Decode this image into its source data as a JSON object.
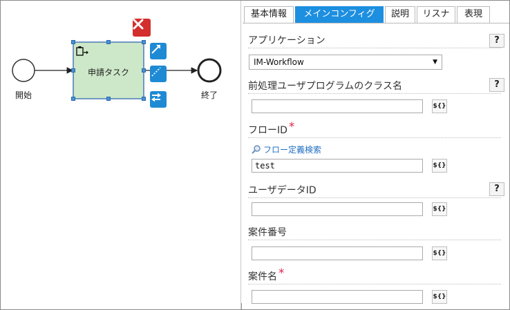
{
  "canvas": {
    "start_label": "開始",
    "task_label": "申請タスク",
    "end_label": "終了"
  },
  "tabs": [
    {
      "label": "基本情報",
      "active": false
    },
    {
      "label": "メインコンフィグ",
      "active": true
    },
    {
      "label": "説明",
      "active": false
    },
    {
      "label": "リスナ",
      "active": false
    },
    {
      "label": "表現",
      "active": false
    }
  ],
  "form": {
    "application": {
      "label": "アプリケーション",
      "help": "?",
      "selected": "IM-Workflow"
    },
    "preprocess": {
      "label": "前処理ユーザプログラムのクラス名",
      "help": "?",
      "value": "",
      "var_button": "${}"
    },
    "flow_id": {
      "label": "フローID",
      "required_mark": "*",
      "search_link": "フロー定義検索",
      "value": "test",
      "var_button": "${}"
    },
    "user_data_id": {
      "label": "ユーザデータID",
      "help": "?",
      "value": "",
      "var_button": "${}"
    },
    "matter_number": {
      "label": "案件番号",
      "value": "",
      "var_button": "${}"
    },
    "matter_name": {
      "label": "案件名",
      "required_mark": "*",
      "value": "",
      "var_button": "${}"
    }
  },
  "colors": {
    "accent": "#1d8fe0",
    "task_fill": "#cde8c8",
    "delete": "#d32f2f",
    "required": "#e0244a",
    "link": "#1f6fc0"
  }
}
